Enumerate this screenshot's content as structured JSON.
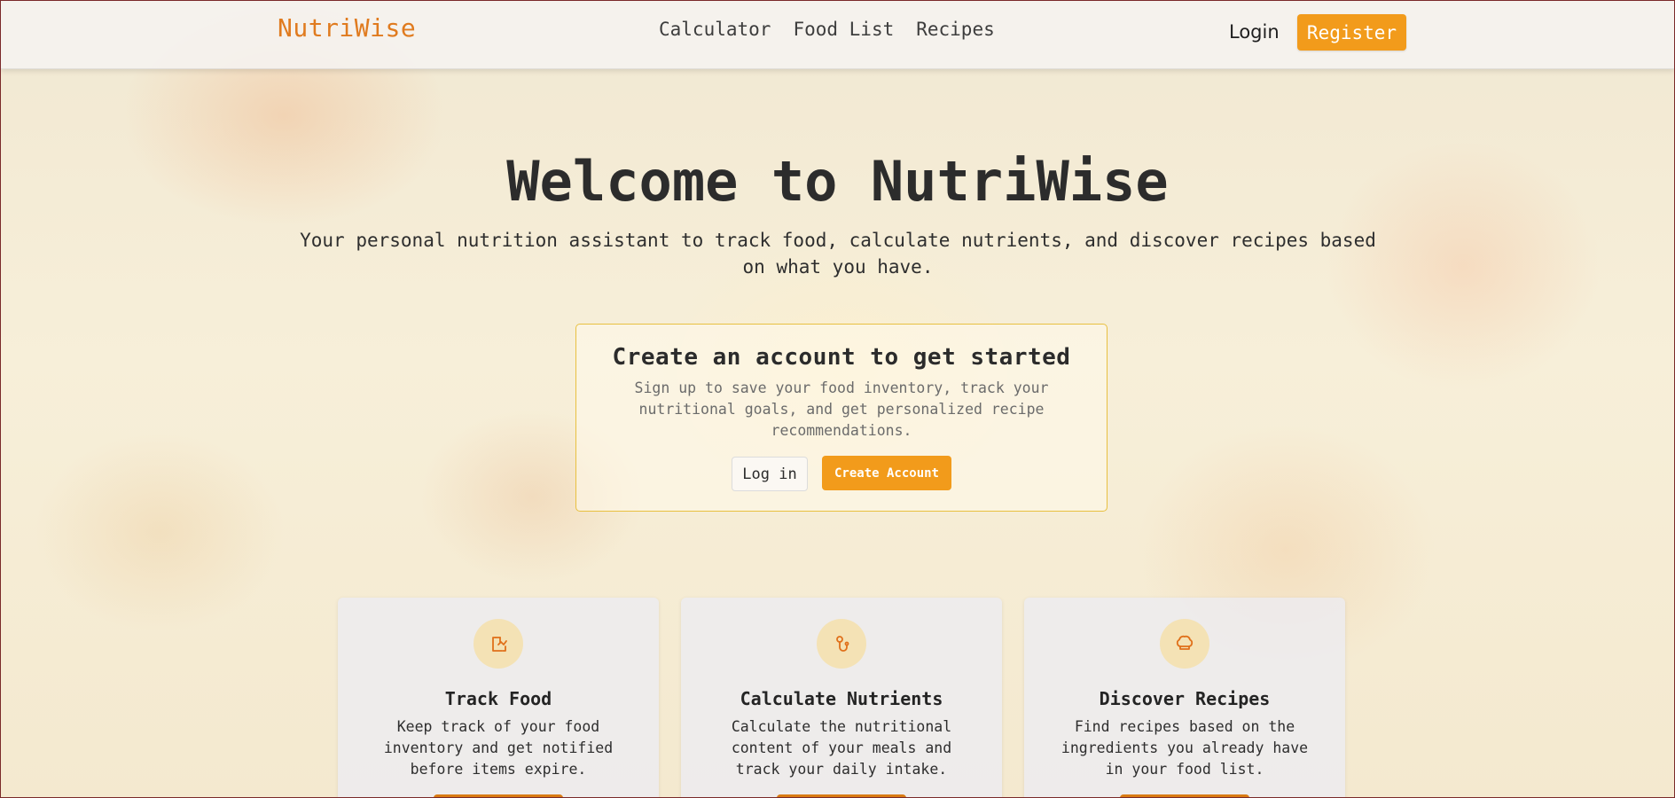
{
  "brand": {
    "name": "NutriWise",
    "color": "#e07b1f"
  },
  "nav": {
    "links": [
      {
        "label": "Calculator"
      },
      {
        "label": "Food List"
      },
      {
        "label": "Recipes"
      }
    ],
    "login_label": "Login",
    "register_label": "Register"
  },
  "hero": {
    "title": "Welcome to NutriWise",
    "subtitle": "Your personal nutrition assistant to track food, calculate nutrients, and discover recipes based on what you have."
  },
  "cta": {
    "title": "Create an account to get started",
    "text": "Sign up to save your food inventory, track your nutritional goals, and get personalized recipe recommendations.",
    "login_label": "Log in",
    "create_label": "Create Account"
  },
  "features": [
    {
      "icon": "clipboard-icon",
      "title": "Track Food",
      "text": "Keep track of your food inventory and get notified before items expire."
    },
    {
      "icon": "stethoscope-icon",
      "title": "Calculate Nutrients",
      "text": "Calculate the nutritional content of your meals and track your daily intake."
    },
    {
      "icon": "chef-hat-icon",
      "title": "Discover Recipes",
      "text": "Find recipes based on the ingredients you already have in your food list."
    }
  ],
  "colors": {
    "accent": "#f29b1b",
    "accent_dark": "#d97a12",
    "icon": "#e0701a",
    "icon_bg": "#f4e2b5",
    "cta_border": "#e8c040"
  }
}
